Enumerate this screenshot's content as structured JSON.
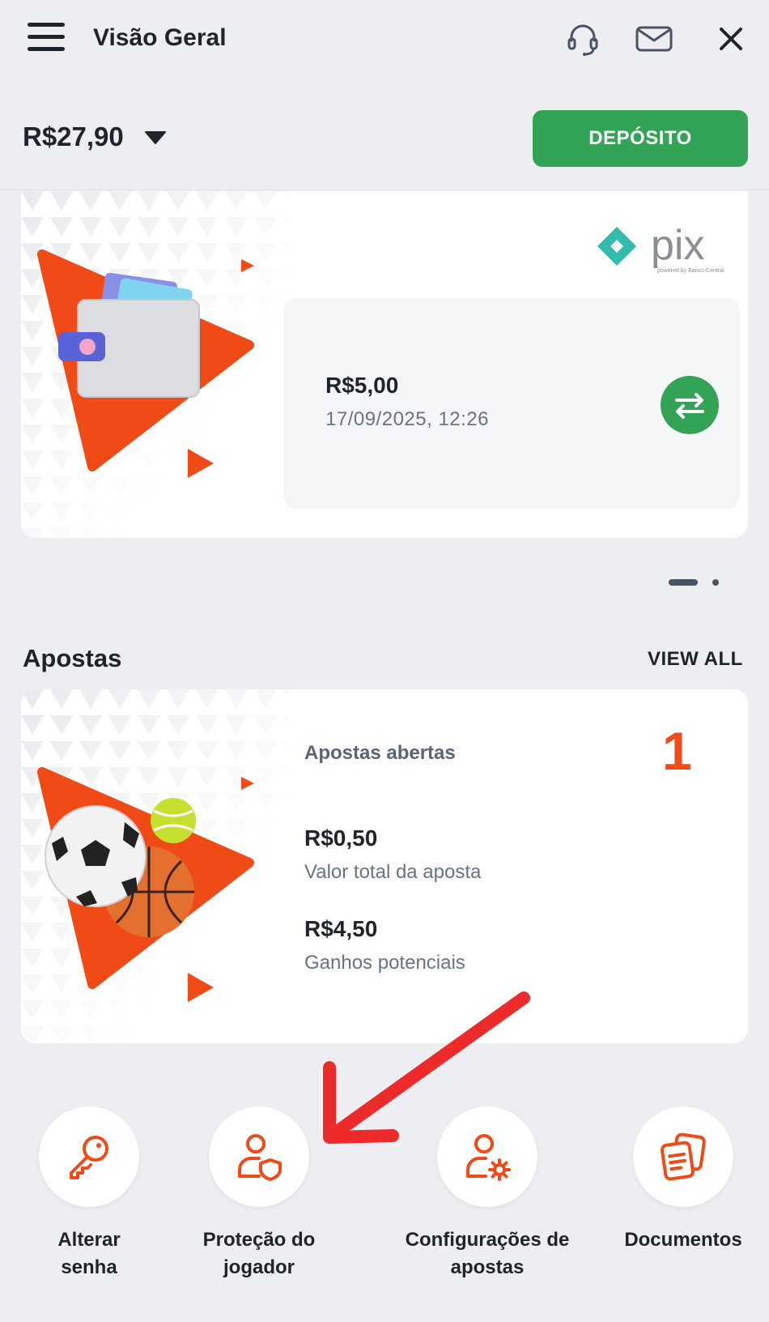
{
  "header": {
    "title": "Visão Geral",
    "balance": "R$27,90",
    "deposit_label": "DEPÓSITO"
  },
  "transaction_card": {
    "logo_text": "pix",
    "logo_subtext": "powered by Banco Central",
    "amount": "R$5,00",
    "datetime": "17/09/2025, 12:26"
  },
  "carousel": {
    "total_pages": 2,
    "active_page": 1
  },
  "bets": {
    "section_title": "Apostas",
    "view_all_label": "VIEW ALL",
    "open_bets_label": "Apostas abertas",
    "open_bets_count": "1",
    "stake_value": "R$0,50",
    "stake_label": "Valor total da aposta",
    "potential_value": "R$4,50",
    "potential_label": "Ganhos potenciais"
  },
  "actions": [
    {
      "label_line1": "Alterar",
      "label_line2": "senha",
      "icon": "key-icon"
    },
    {
      "label_line1": "Proteção do",
      "label_line2": "jogador",
      "icon": "user-shield-icon"
    },
    {
      "label_line1": "Configurações de",
      "label_line2": "apostas",
      "icon": "user-gear-icon"
    },
    {
      "label_line1": "Documentos",
      "label_line2": "",
      "icon": "documents-icon"
    }
  ],
  "colors": {
    "accent_green": "#33a356",
    "accent_orange": "#f04a16",
    "annotation_red": "#ee2b2b",
    "background": "#eceef1"
  }
}
